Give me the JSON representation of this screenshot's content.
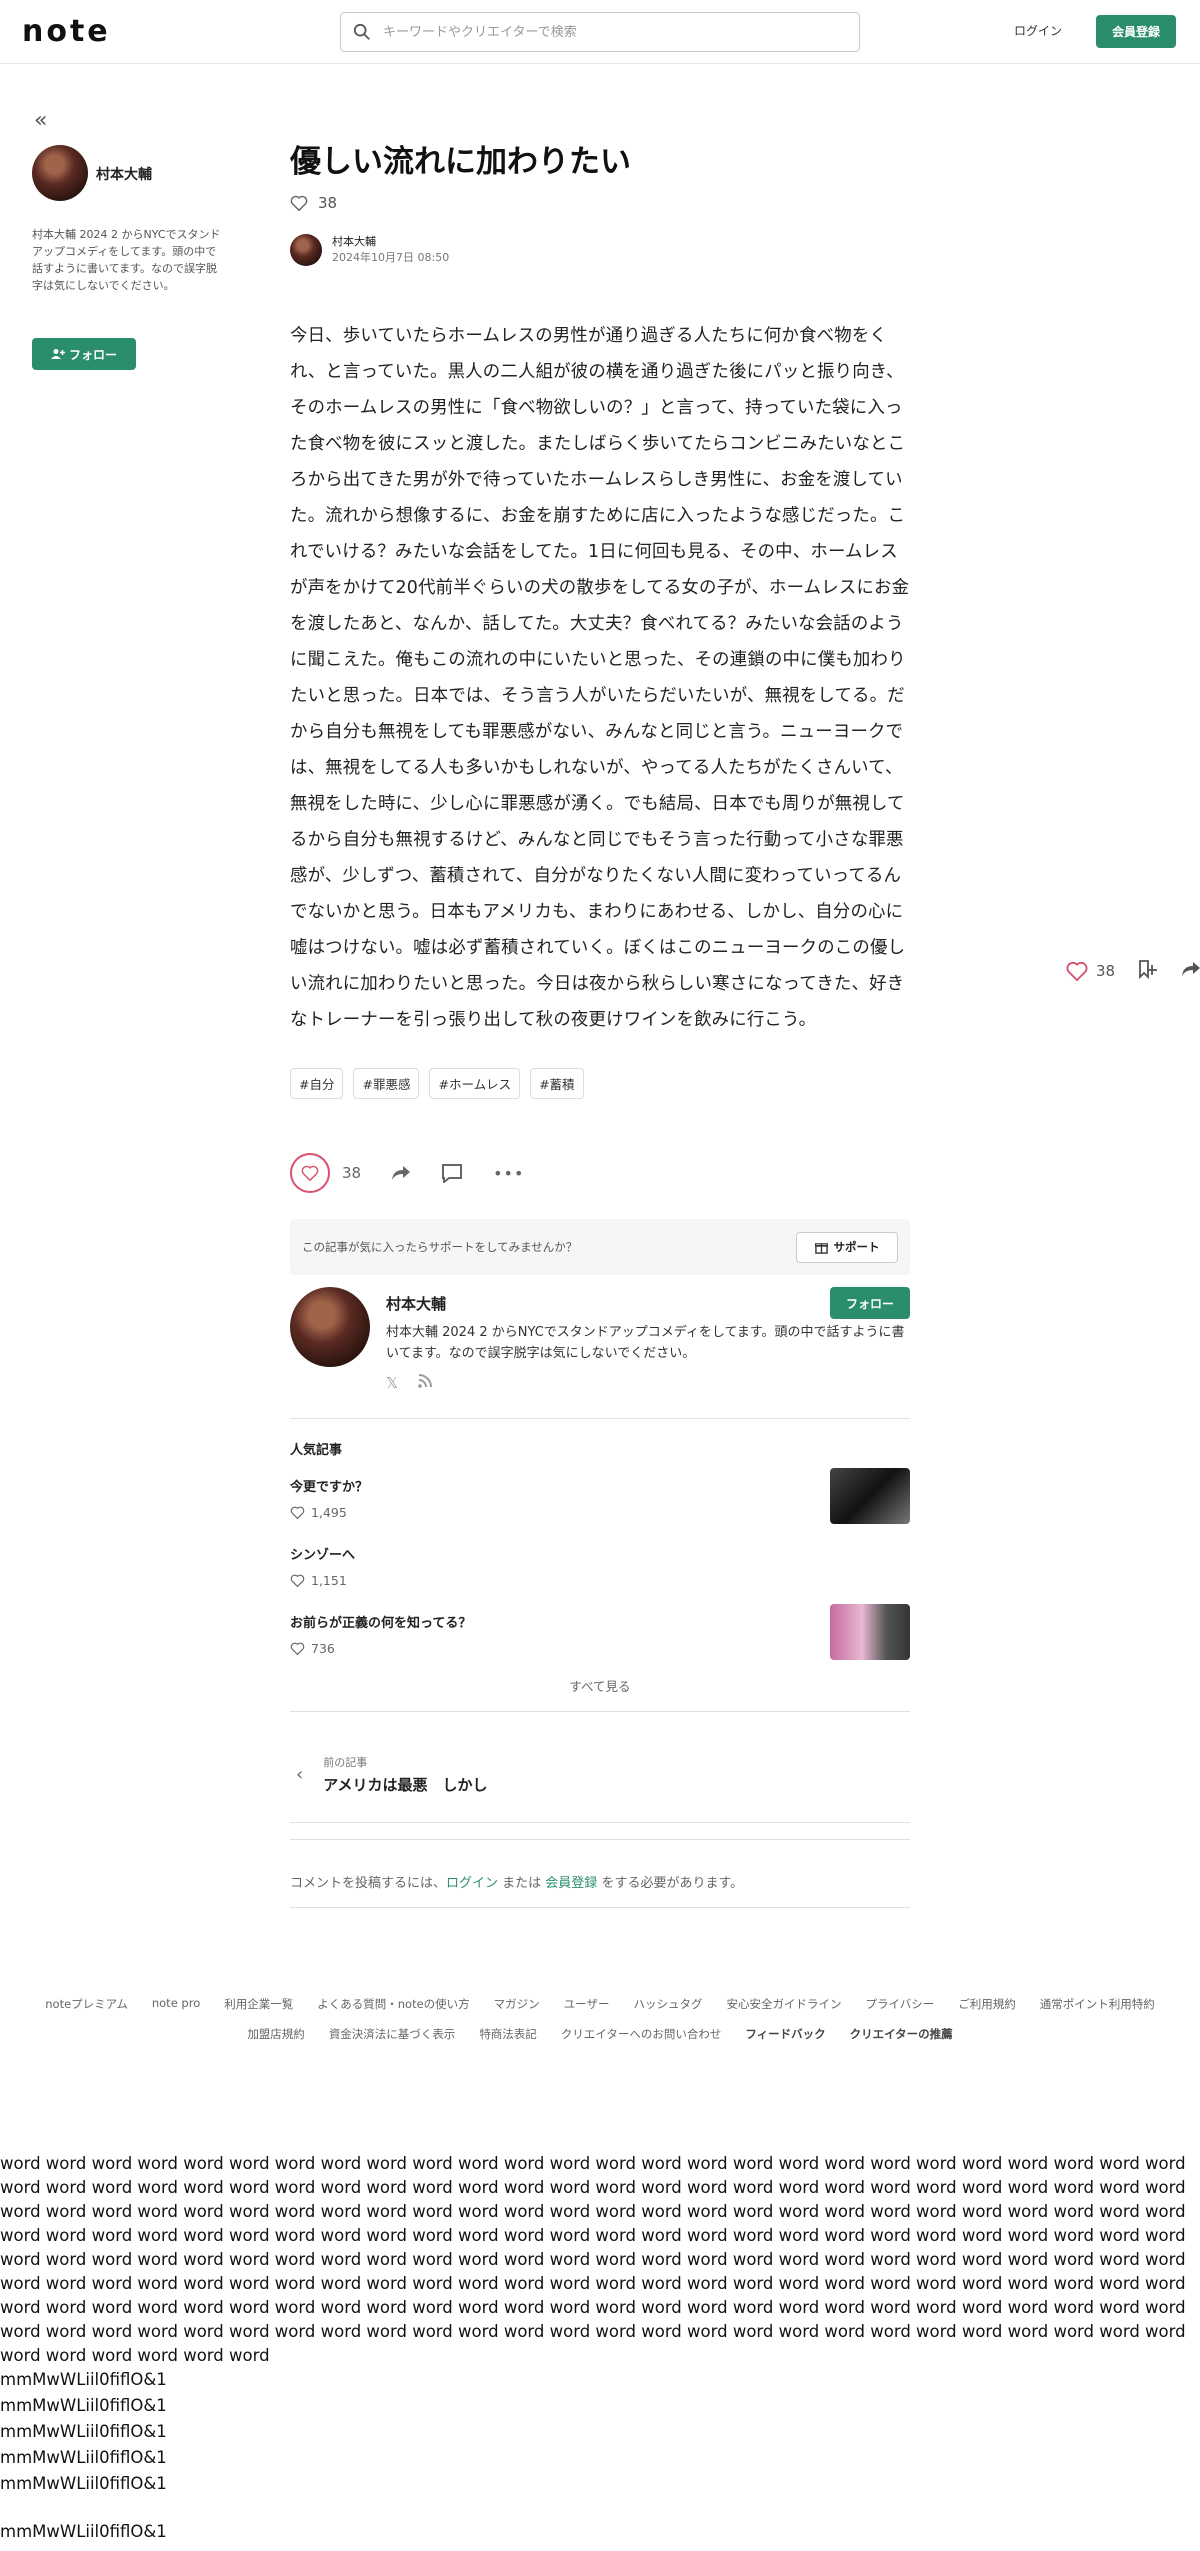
{
  "header": {
    "logo": "note",
    "search_placeholder": "キーワードやクリエイターで検索",
    "login_label": "ログイン",
    "signup_label": "会員登録"
  },
  "sidebar": {
    "author_name": "村本大輔",
    "bio": "村本大輔 2024 2 からNYCでスタンドアップコメディをしてます。頭の中で話すように書いてます。なので誤字脱字は気にしないでください。",
    "follow_label": "フォロー"
  },
  "article": {
    "title": "優しい流れに加わりたい",
    "like_count": "38",
    "author_name": "村本大輔",
    "date": "2024年10月7日 08:50",
    "body": "今日、歩いていたらホームレスの男性が通り過ぎる人たちに何か食べ物をくれ、と言っていた。黒人の二人組が彼の横を通り過ぎた後にパッと振り向き、そのホームレスの男性に「食べ物欲しいの？」と言って、持っていた袋に入った食べ物を彼にスッと渡した。またしばらく歩いてたらコンビニみたいなところから出てきた男が外で待っていたホームレスらしき男性に、お金を渡していた。流れから想像するに、お金を崩すために店に入ったような感じだった。これでいける？みたいな会話をしてた。1日に何回も見る、その中、ホームレスが声をかけて20代前半ぐらいの犬の散歩をしてる女の子が、ホームレスにお金を渡したあと、なんか、話してた。大丈夫？食べれてる？みたいな会話のように聞こえた。俺もこの流れの中にいたいと思った、その連鎖の中に僕も加わりたいと思った。日本では、そう言う人がいたらだいたいが、無視をしてる。だから自分も無視をしても罪悪感がない、みんなと同じと言う。ニューヨークでは、無視をしてる人も多いかもしれないが、やってる人たちがたくさんいて、無視をした時に、少し心に罪悪感が湧く。でも結局、日本でも周りが無視してるから自分も無視するけど、みんなと同じでもそう言った行動って小さな罪悪感が、少しずつ、蓄積されて、自分がなりたくない人間に変わっていってるんでないかと思う。日本もアメリカも、まわりにあわせる、しかし、自分の心に嘘はつけない。嘘は必ず蓄積されていく。ぼくはこのニューヨークのこの優しい流れに加わりたいと思った。今日は夜から秋らしい寒さになってきた、好きなトレーナーを引っ張り出して秋の夜更けワインを飲みに行こう。",
    "tags": [
      "#自分",
      "#罪悪感",
      "#ホームレス",
      "#蓄積"
    ]
  },
  "actions": {
    "like_count": "38"
  },
  "support": {
    "prompt": "この記事が気に入ったらサポートをしてみませんか？",
    "button_label": "サポート"
  },
  "profile": {
    "name": "村本大輔",
    "follow_label": "フォロー",
    "bio": "村本大輔 2024 2 からNYCでスタンドアップコメディをしてます。頭の中で話すように書いてます。なので誤字脱字は気にしないでください。"
  },
  "popular": {
    "heading": "人気記事",
    "items": [
      {
        "title": "今更ですか？",
        "likes": "1,495"
      },
      {
        "title": "シンゾーへ",
        "likes": "1,151"
      },
      {
        "title": "お前らが正義の何を知ってる？",
        "likes": "736"
      }
    ],
    "see_all": "すべて見る"
  },
  "prev": {
    "label": "前の記事",
    "title": "アメリカは最悪　しかし"
  },
  "comment": {
    "prefix": "コメントを投稿するには、",
    "login": "ログイン",
    "mid": " または ",
    "signup": "会員登録",
    "suffix": " をする必要があります。"
  },
  "float": {
    "like_count": "38"
  },
  "footer": {
    "row1": [
      "noteプレミアム",
      "note pro",
      "利用企業一覧",
      "よくある質問・noteの使い方",
      "マガジン",
      "ユーザー",
      "ハッシュタグ",
      "安心安全ガイドライン",
      "プライバシー",
      "ご利用規約",
      "通常ポイント利用特約"
    ],
    "row2": [
      "加盟店規約",
      "資金決済法に基づく表示",
      "特商法表記",
      "クリエイターへのお問い合わせ"
    ],
    "row2_bold": [
      "フィードバック",
      "クリエイターの推薦"
    ]
  },
  "filler": {
    "word_text": "word word word word word word word word word word word word word word word word word word word word word word word word word word word word word word word word word word word word word word word word word word word word word word word word word word word word word word word word word word word word word word word word word word word word word word word word word word word word word word word word word word word word word word word word word word word word word word word word word word word word word word word word word word word word word word word word word word word word word word word word word word word word word word word word word word word word word word word word word word word word word word word word word word word word word word word word word word word word word word word word word word word word word word word word word word word word word word word word word word word word word word word word word word word word word word word word word word word word word word word word word word word word word word word word word word word word word word",
    "glyph_lines": [
      "mmMwWLiil0fiflO&1",
      "mmMwWLiil0fiflO&1",
      "mmMwWLiil0fiflO&1",
      "mmMwWLiil0fiflO&1",
      "mmMwWLiil0fiflO&1",
      "mmMwWLiil0fiflO&1"
    ]
  }
}
